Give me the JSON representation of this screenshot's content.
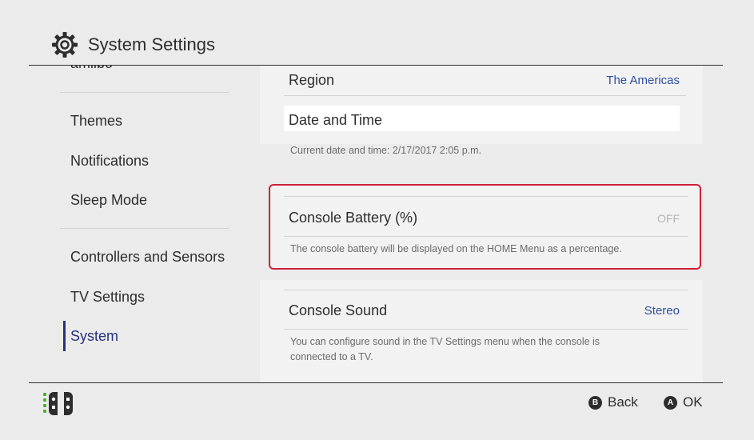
{
  "header": {
    "title": "System Settings",
    "icon": "gear-icon"
  },
  "sidebar": {
    "items": [
      {
        "label": "amiibo"
      },
      {
        "label": "Themes"
      },
      {
        "label": "Notifications"
      },
      {
        "label": "Sleep Mode"
      },
      {
        "label": "Controllers and Sensors"
      },
      {
        "label": "TV Settings"
      },
      {
        "label": "System",
        "selected": true
      }
    ]
  },
  "main": {
    "region": {
      "label": "Region",
      "value": "The Americas"
    },
    "date_time": {
      "label": "Date and Time",
      "desc": "Current date and time: 2/17/2017 2:05 p.m."
    },
    "battery": {
      "label": "Console Battery (%)",
      "value": "OFF",
      "desc": "The console battery will be displayed on the HOME Menu as a percentage."
    },
    "sound": {
      "label": "Console Sound",
      "value": "Stereo",
      "desc": "You can configure sound in the TV Settings menu when the console is connected to a TV."
    }
  },
  "footer": {
    "controller_icon": "joycon-icon",
    "back": {
      "button": "B",
      "label": "Back"
    },
    "ok": {
      "button": "A",
      "label": "OK"
    }
  },
  "colors": {
    "accent": "#27327d",
    "value_blue": "#2f4ea3",
    "highlight_red": "#d0203a",
    "background": "#ebebeb"
  }
}
